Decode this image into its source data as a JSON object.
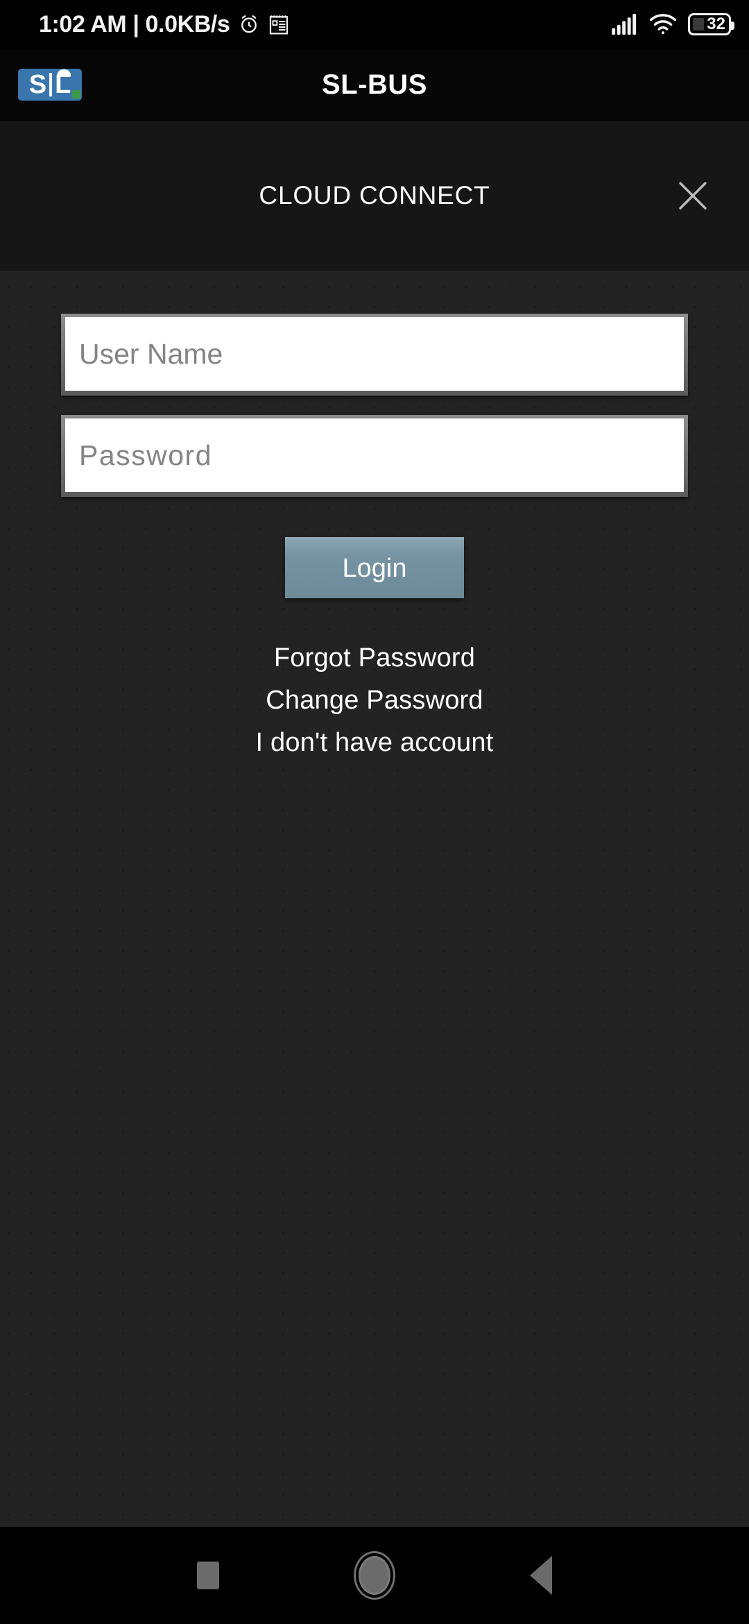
{
  "status_bar": {
    "clock": "1:02 AM | 0.0KB/s",
    "alarm_icon": "alarm-clock-icon",
    "note_icon": "note-calendar-icon",
    "signal_icon": "cellular-signal-icon",
    "wifi_icon": "wifi-icon",
    "battery_level": "32",
    "battery_icon": "battery-icon"
  },
  "app_bar": {
    "logo_s": "S",
    "logo_l": "L",
    "logo_alt": "sl-logo",
    "title": "SL-BUS",
    "logo_color": "#3a76ad",
    "logo_accent_color": "#3f9a45"
  },
  "connect_bar": {
    "title": "CLOUD CONNECT",
    "close_icon": "close-icon",
    "close_label": "Close"
  },
  "login_form": {
    "username": {
      "value": "",
      "placeholder": "User Name"
    },
    "password": {
      "value": "",
      "placeholder": "Password"
    },
    "submit_label": "Login",
    "submit_color": "#7693a2",
    "links": [
      {
        "label": "Forgot Password",
        "name": "forgot-password-link"
      },
      {
        "label": "Change Password",
        "name": "change-password-link"
      },
      {
        "label": "I don't have account",
        "name": "create-account-link"
      }
    ]
  },
  "nav_bar": {
    "recents_label": "Recents",
    "home_label": "Home",
    "back_label": "Back"
  },
  "theme": {
    "background": "#232323",
    "header_background": "#161616",
    "status_background": "#000000",
    "text": "#ffffff"
  }
}
